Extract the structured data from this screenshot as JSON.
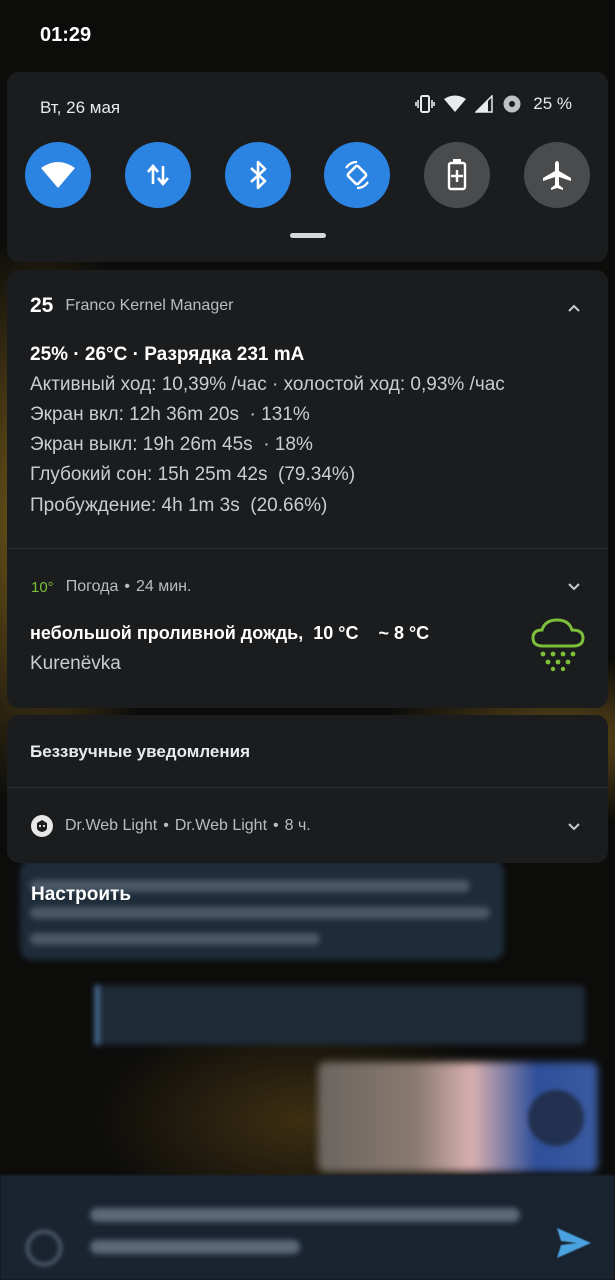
{
  "status_bar": {
    "time": "01:29"
  },
  "quick_settings": {
    "date": "Вт, 26 мая",
    "battery_percent": "25 %",
    "tiles": [
      {
        "icon": "wifi-icon",
        "active": true
      },
      {
        "icon": "mobile-data-icon",
        "active": true
      },
      {
        "icon": "bluetooth-icon",
        "active": true
      },
      {
        "icon": "auto-rotate-icon",
        "active": true
      },
      {
        "icon": "battery-saver-icon",
        "active": false
      },
      {
        "icon": "airplane-mode-icon",
        "active": false
      }
    ],
    "colors": {
      "active": "#2b83e2",
      "inactive": "#4a4b4d"
    }
  },
  "notifications": {
    "franco": {
      "badge": "25",
      "app_name": "Franco Kernel Manager",
      "title": "25% · 26°C · Разрядка 231 mA",
      "lines": [
        "Активный ход: 10,39% /час · холостой ход: 0,93% /час",
        "Экран вкл: 12h 36m 20s  · 131%",
        "Экран выкл: 19h 26m 45s  · 18%",
        "Глубокий сон: 15h 25m 42s  (79.34%)",
        "Пробуждение: 4h 1m 3s  (20.66%)"
      ]
    },
    "weather": {
      "temp_badge": "10°",
      "app_name": "Погода",
      "time": "24 мин.",
      "title": "небольшой проливной дождь,  10 °C    ~ 8 °C",
      "location": "Kurenёvka",
      "icon": "rain-cloud-icon",
      "accent": "#7bbf3a"
    },
    "silent": {
      "section_title": "Беззвучные уведомления",
      "drweb": {
        "app_name": "Dr.Web Light",
        "title": "Dr.Web Light",
        "time": "8 ч."
      }
    }
  },
  "configure_label": "Настроить"
}
